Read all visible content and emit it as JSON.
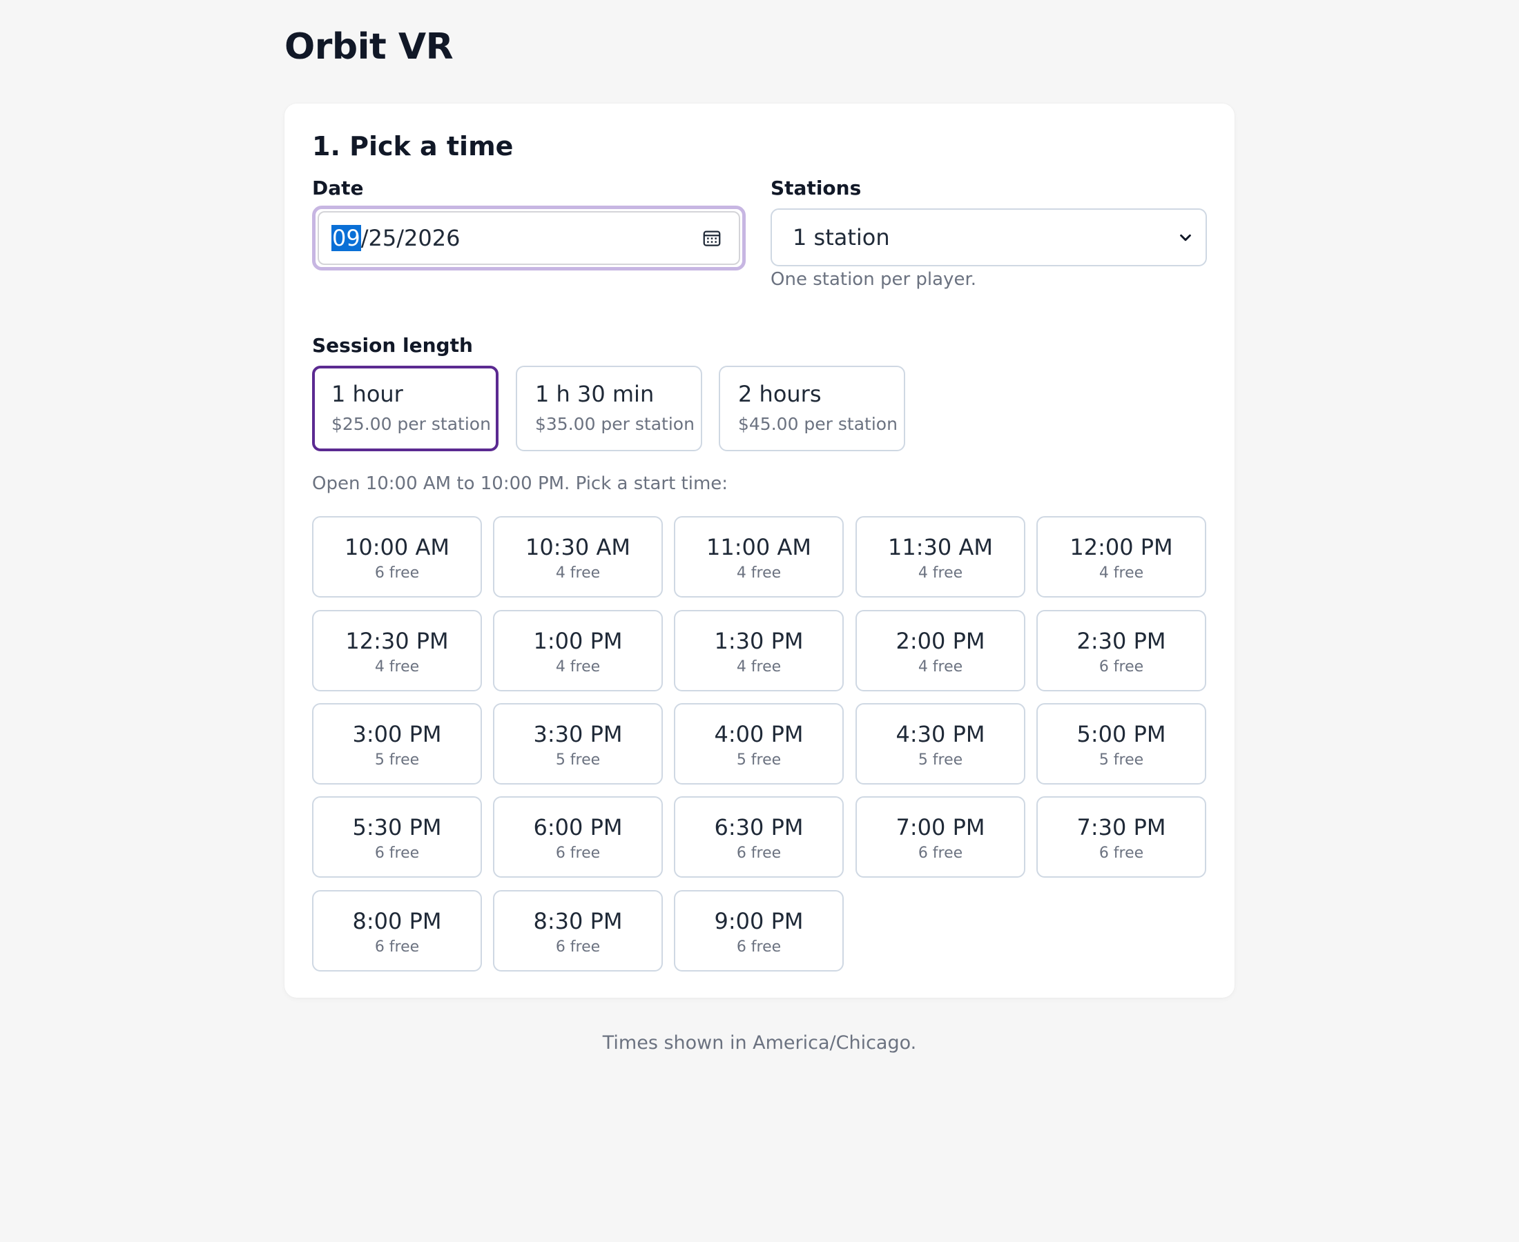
{
  "app": {
    "title": "Orbit VR"
  },
  "step": {
    "title": "1. Pick a time"
  },
  "date": {
    "label": "Date",
    "month": "09",
    "rest": "/25/2026"
  },
  "stations": {
    "label": "Stations",
    "selected": "1 station",
    "hint": "One station per player."
  },
  "session": {
    "label": "Session length",
    "options": [
      {
        "label": "1 hour",
        "price": "$25.00 per station",
        "selected": true
      },
      {
        "label": "1 h 30 min",
        "price": "$35.00 per station",
        "selected": false
      },
      {
        "label": "2 hours",
        "price": "$45.00 per station",
        "selected": false
      }
    ]
  },
  "schedule": {
    "intro": "Open 10:00 AM to 10:00 PM. Pick a start time:",
    "slots": [
      {
        "time": "10:00 AM",
        "free": "6 free"
      },
      {
        "time": "10:30 AM",
        "free": "4 free"
      },
      {
        "time": "11:00 AM",
        "free": "4 free"
      },
      {
        "time": "11:30 AM",
        "free": "4 free"
      },
      {
        "time": "12:00 PM",
        "free": "4 free"
      },
      {
        "time": "12:30 PM",
        "free": "4 free"
      },
      {
        "time": "1:00 PM",
        "free": "4 free"
      },
      {
        "time": "1:30 PM",
        "free": "4 free"
      },
      {
        "time": "2:00 PM",
        "free": "4 free"
      },
      {
        "time": "2:30 PM",
        "free": "6 free"
      },
      {
        "time": "3:00 PM",
        "free": "5 free"
      },
      {
        "time": "3:30 PM",
        "free": "5 free"
      },
      {
        "time": "4:00 PM",
        "free": "5 free"
      },
      {
        "time": "4:30 PM",
        "free": "5 free"
      },
      {
        "time": "5:00 PM",
        "free": "5 free"
      },
      {
        "time": "5:30 PM",
        "free": "6 free"
      },
      {
        "time": "6:00 PM",
        "free": "6 free"
      },
      {
        "time": "6:30 PM",
        "free": "6 free"
      },
      {
        "time": "7:00 PM",
        "free": "6 free"
      },
      {
        "time": "7:30 PM",
        "free": "6 free"
      },
      {
        "time": "8:00 PM",
        "free": "6 free"
      },
      {
        "time": "8:30 PM",
        "free": "6 free"
      },
      {
        "time": "9:00 PM",
        "free": "6 free"
      }
    ]
  },
  "footer": {
    "note": "Times shown in America/Chicago."
  },
  "colors": {
    "accent": "#5b2a91",
    "focus_ring": "#c7b6e2",
    "selection": "#0a6fd6",
    "border": "#cfd8e3",
    "muted": "#6b7280"
  }
}
